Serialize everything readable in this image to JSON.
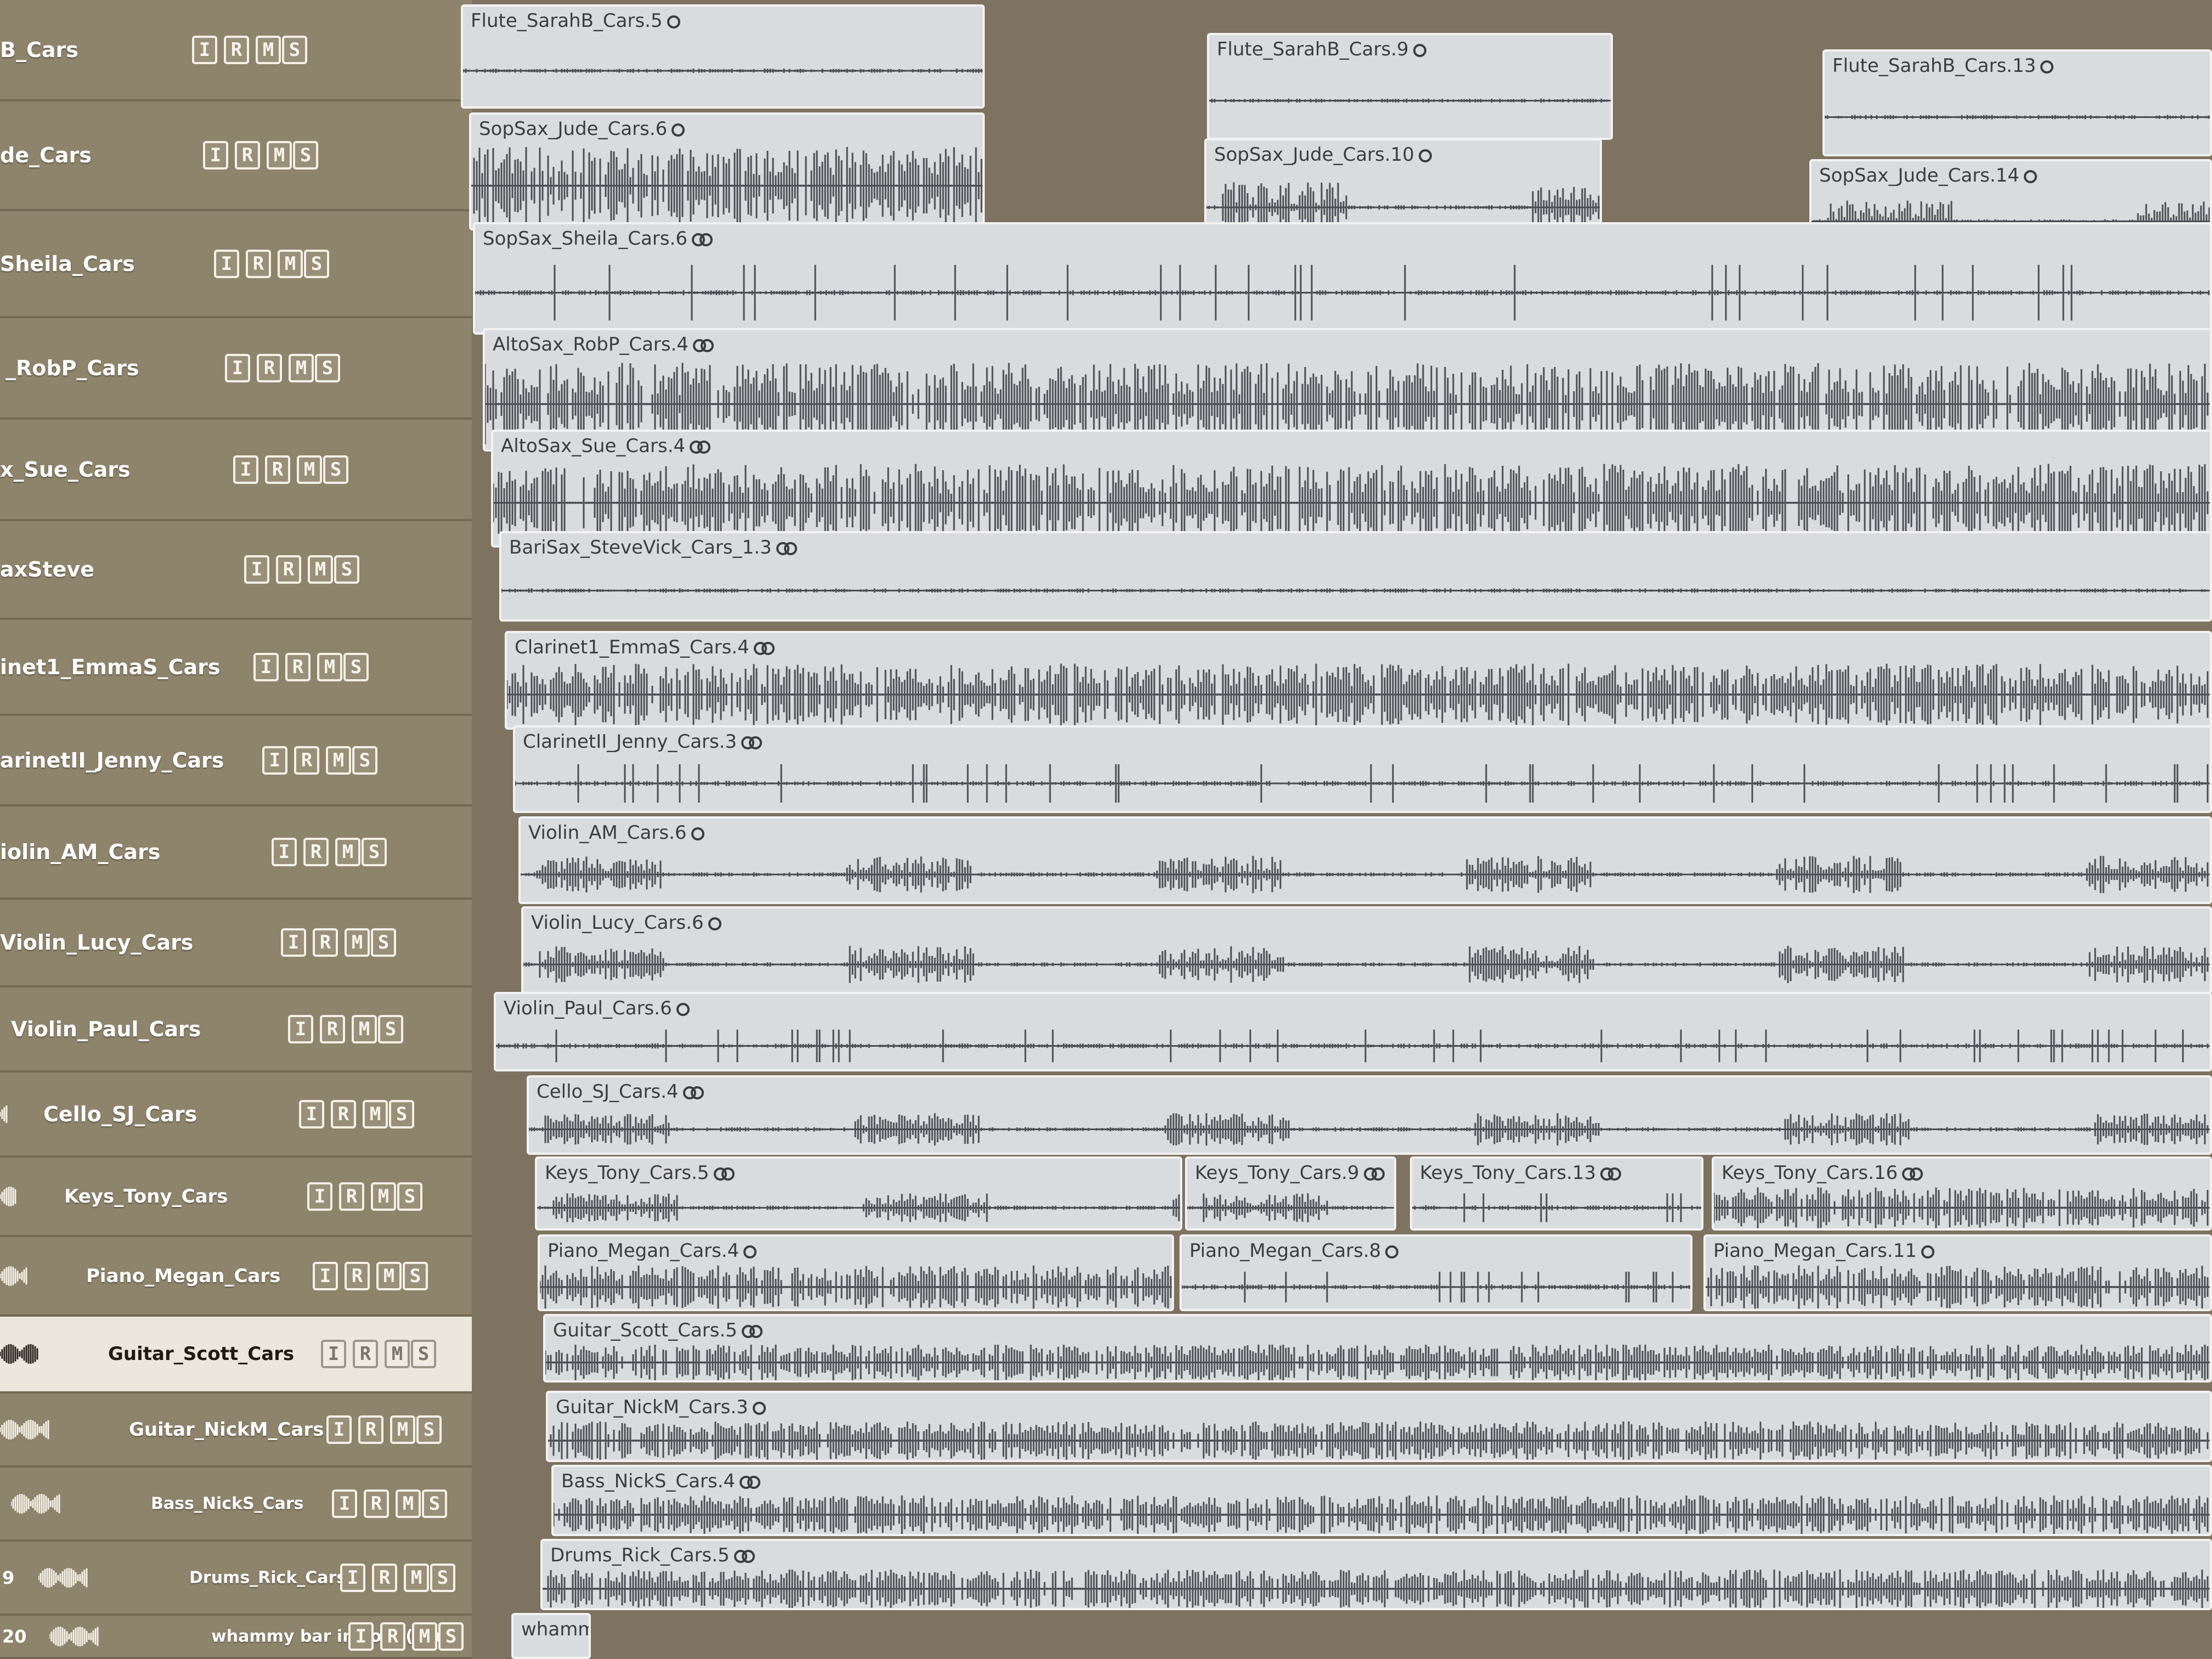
{
  "colors": {
    "header_bg": "#8e836b",
    "arrange_bg": "#7e7260",
    "region_bg": "#d9dcdf",
    "waveform": "#4a4d52",
    "selected_row": "#ece7dd"
  },
  "buttons": {
    "input": "I",
    "record": "R",
    "mute": "M",
    "solo": "S"
  },
  "tracks": [
    {
      "name": "B_Cars",
      "num": "",
      "selected": false
    },
    {
      "name": "de_Cars",
      "num": "",
      "selected": false
    },
    {
      "name": "Sheila_Cars",
      "num": "",
      "selected": false
    },
    {
      "name": "_RobP_Cars",
      "num": "",
      "selected": false
    },
    {
      "name": "x_Sue_Cars",
      "num": "",
      "selected": false
    },
    {
      "name": "axSteve",
      "num": "",
      "selected": false
    },
    {
      "name": "inet1_EmmaS_Cars",
      "num": "",
      "selected": false
    },
    {
      "name": "arinetII_Jenny_Cars",
      "num": "",
      "selected": false
    },
    {
      "name": "iolin_AM_Cars",
      "num": "",
      "selected": false
    },
    {
      "name": "Violin_Lucy_Cars",
      "num": "",
      "selected": false
    },
    {
      "name": "Violin_Paul_Cars",
      "num": "",
      "selected": false
    },
    {
      "name": "Cello_SJ_Cars",
      "num": "",
      "selected": false
    },
    {
      "name": "Keys_Tony_Cars",
      "num": "",
      "selected": false
    },
    {
      "name": "Piano_Megan_Cars",
      "num": "",
      "selected": false
    },
    {
      "name": "Guitar_Scott_Cars",
      "num": "",
      "selected": true
    },
    {
      "name": "Guitar_NickM_Cars",
      "num": "",
      "selected": false
    },
    {
      "name": "Bass_NickS_Cars",
      "num": "",
      "selected": false
    },
    {
      "name": "Drums_Rick_Cars",
      "num": "9",
      "selected": false
    },
    {
      "name": "whammy bar intro A (var...",
      "num": "20",
      "selected": false
    }
  ],
  "regions": [
    {
      "title": "Flute_SarahB_Cars.5",
      "loop": "circle",
      "wave": "quiet"
    },
    {
      "title": "Flute_SarahB_Cars.9",
      "loop": "circle",
      "wave": "quiet"
    },
    {
      "title": "Flute_SarahB_Cars.13",
      "loop": "circle",
      "wave": "quiet"
    },
    {
      "title": "SopSax_Jude_Cars.6",
      "loop": "circle",
      "wave": "heavy"
    },
    {
      "title": "SopSax_Jude_Cars.10",
      "loop": "circle",
      "wave": "medium"
    },
    {
      "title": "SopSax_Jude_Cars.14",
      "loop": "circle",
      "wave": "medium"
    },
    {
      "title": "SopSax_Sheila_Cars.6",
      "loop": "double",
      "wave": "sparse"
    },
    {
      "title": "AltoSax_RobP_Cars.4",
      "loop": "double",
      "wave": "heavy"
    },
    {
      "title": "AltoSax_Sue_Cars.4",
      "loop": "double",
      "wave": "heavy"
    },
    {
      "title": "BariSax_SteveVick_Cars_1.3",
      "loop": "double",
      "wave": "quiet"
    },
    {
      "title": "Clarinet1_EmmaS_Cars.4",
      "loop": "double",
      "wave": "heavy"
    },
    {
      "title": "ClarinetII_Jenny_Cars.3",
      "loop": "double",
      "wave": "sparse"
    },
    {
      "title": "Violin_AM_Cars.6",
      "loop": "circle",
      "wave": "medium"
    },
    {
      "title": "Violin_Lucy_Cars.6",
      "loop": "circle",
      "wave": "medium"
    },
    {
      "title": "Violin_Paul_Cars.6",
      "loop": "circle",
      "wave": "sparse"
    },
    {
      "title": "Cello_SJ_Cars.4",
      "loop": "double",
      "wave": "medium"
    },
    {
      "title": "Keys_Tony_Cars.5",
      "loop": "double",
      "wave": "medium"
    },
    {
      "title": "Keys_Tony_Cars.9",
      "loop": "double",
      "wave": "medium"
    },
    {
      "title": "Keys_Tony_Cars.13",
      "loop": "double",
      "wave": "sparse"
    },
    {
      "title": "Keys_Tony_Cars.16",
      "loop": "double",
      "wave": "heavy"
    },
    {
      "title": "Piano_Megan_Cars.4",
      "loop": "circle",
      "wave": "heavy"
    },
    {
      "title": "Piano_Megan_Cars.8",
      "loop": "circle",
      "wave": "sparse"
    },
    {
      "title": "Piano_Megan_Cars.11",
      "loop": "circle",
      "wave": "heavy"
    },
    {
      "title": "Guitar_Scott_Cars.5",
      "loop": "double",
      "wave": "heavy"
    },
    {
      "title": "Guitar_NickM_Cars.3",
      "loop": "circle",
      "wave": "heavy"
    },
    {
      "title": "Bass_NickS_Cars.4",
      "loop": "double",
      "wave": "heavy"
    },
    {
      "title": "Drums_Rick_Cars.5",
      "loop": "double",
      "wave": "heavy"
    },
    {
      "title": "whammy",
      "loop": "none",
      "wave": "none"
    }
  ]
}
